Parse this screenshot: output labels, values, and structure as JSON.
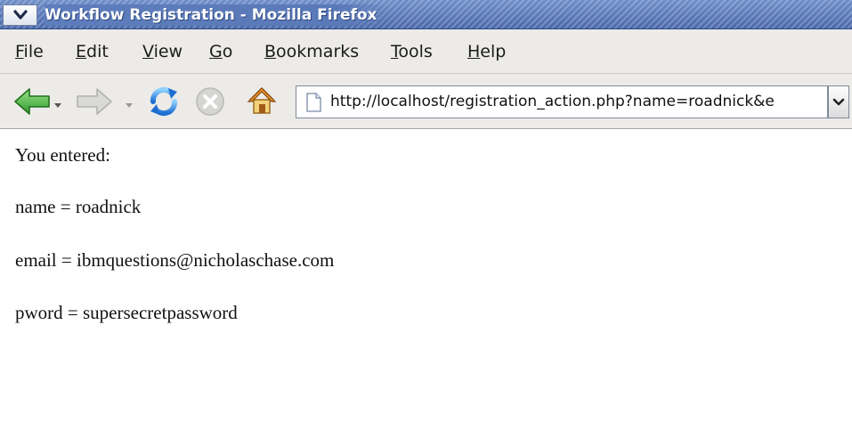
{
  "window": {
    "title": "Workflow Registration - Mozilla Firefox"
  },
  "menubar": {
    "items": [
      {
        "label": "File",
        "accel": "F"
      },
      {
        "label": "Edit",
        "accel": "E"
      },
      {
        "label": "View",
        "accel": "V"
      },
      {
        "label": "Go",
        "accel": "G"
      },
      {
        "label": "Bookmarks",
        "accel": "B"
      },
      {
        "label": "Tools",
        "accel": "T"
      },
      {
        "label": "Help",
        "accel": "H"
      }
    ]
  },
  "navbar": {
    "icons": [
      "back-arrow-icon",
      "forward-arrow-icon",
      "reload-icon",
      "stop-icon",
      "home-icon"
    ],
    "url": "http://localhost/registration_action.php?name=roadnick&e"
  },
  "page": {
    "heading": "You entered:",
    "lines": [
      "name = roadnick",
      "email = ibmquestions@nicholaschase.com",
      "pword = supersecretpassword"
    ]
  },
  "colors": {
    "titlebar": "#5a79b8",
    "chrome": "#ecebe8",
    "back_arrow": "#3fae3a"
  }
}
